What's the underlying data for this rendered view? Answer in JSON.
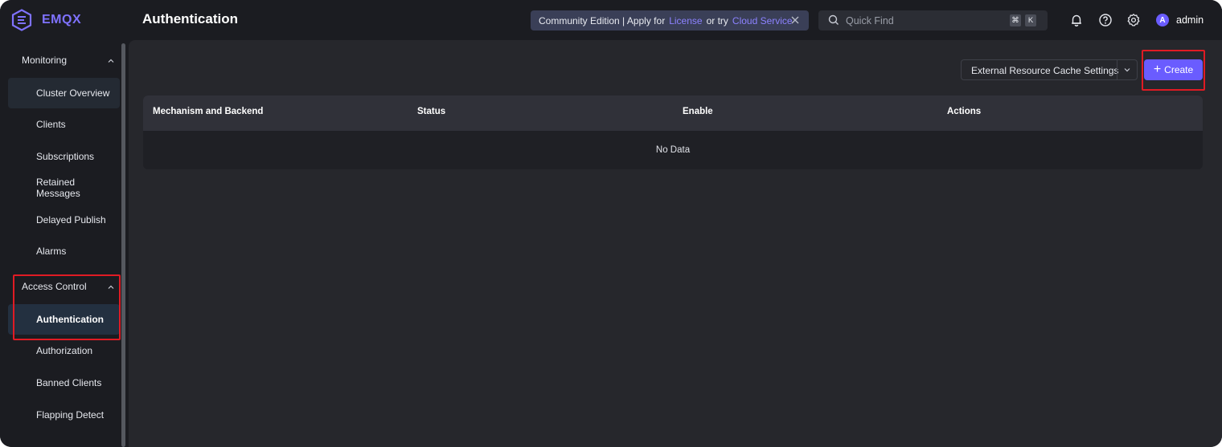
{
  "app": {
    "logo_text": "EMQX"
  },
  "header": {
    "page_title": "Authentication",
    "notice": {
      "prefix": "Community Edition | Apply for",
      "link_license": "License",
      "middle": "or try",
      "link_cloud": "Cloud Service"
    },
    "search": {
      "placeholder": "Quick Find",
      "shortcut_key1": "⌘",
      "shortcut_key2": "K"
    },
    "user": {
      "avatar_initial": "A",
      "name": "admin"
    }
  },
  "sidebar": {
    "groups": [
      {
        "label": "Monitoring",
        "expanded": true,
        "items": [
          {
            "label": "Cluster Overview",
            "active": true
          },
          {
            "label": "Clients",
            "active": false
          },
          {
            "label": "Subscriptions",
            "active": false
          },
          {
            "label": "Retained Messages",
            "active": false
          },
          {
            "label": "Delayed Publish",
            "active": false
          },
          {
            "label": "Alarms",
            "active": false
          }
        ]
      },
      {
        "label": "Access Control",
        "expanded": true,
        "items": [
          {
            "label": "Authentication",
            "active": true
          },
          {
            "label": "Authorization",
            "active": false
          },
          {
            "label": "Banned Clients",
            "active": false
          },
          {
            "label": "Flapping Detect",
            "active": false
          }
        ]
      }
    ]
  },
  "toolbar": {
    "cache_settings_label": "External Resource Cache Settings",
    "create_label": "Create"
  },
  "table": {
    "columns": [
      "Mechanism and Backend",
      "Status",
      "Enable",
      "Actions"
    ],
    "empty_text": "No Data"
  },
  "colors": {
    "accent": "#6a5cff",
    "link": "#8c82ff",
    "highlight": "#e01b24",
    "background": "#1b1c21",
    "panel": "#26272c"
  }
}
